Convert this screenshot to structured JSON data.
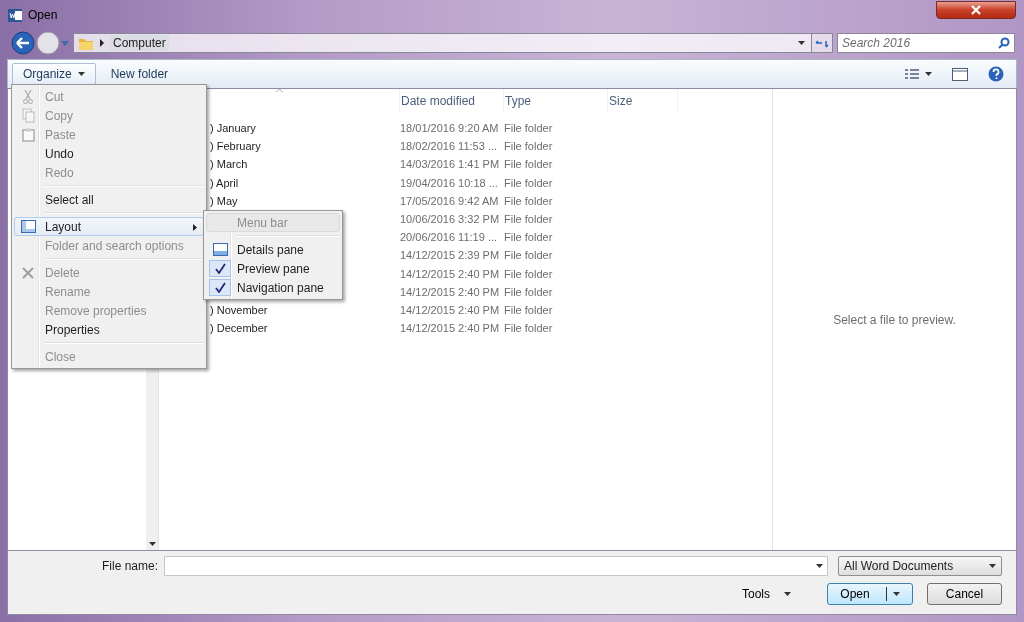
{
  "window": {
    "title": "Open"
  },
  "address": {
    "path": "Computer",
    "search_placeholder": "Search 2016"
  },
  "toolbar": {
    "buttons": [
      {
        "label": "Organize",
        "kind": "menu"
      },
      {
        "label": "New folder",
        "kind": "plain"
      }
    ]
  },
  "file_list": {
    "columns": [
      "Date modified",
      "Type",
      "Size"
    ],
    "rows": [
      {
        "name": ") January",
        "date": "18/01/2016 9:20 AM",
        "type": "File folder"
      },
      {
        "name": ") February",
        "date": "18/02/2016 11:53 ...",
        "type": "File folder"
      },
      {
        "name": ") March",
        "date": "14/03/2016 1:41 PM",
        "type": "File folder"
      },
      {
        "name": ") April",
        "date": "19/04/2016 10:18 ...",
        "type": "File folder"
      },
      {
        "name": ") May",
        "date": "17/05/2016 9:42 AM",
        "type": "File folder"
      },
      {
        "date": "10/06/2016 3:32 PM",
        "type": "File folder"
      },
      {
        "date": "20/06/2016 11:19 ...",
        "type": "File folder"
      },
      {
        "date": "14/12/2015 2:39 PM",
        "type": "File folder"
      },
      {
        "date": "14/12/2015 2:40 PM",
        "type": "File folder"
      },
      {
        "date": "14/12/2015 2:40 PM",
        "type": "File folder"
      },
      {
        "name": ") November",
        "date": "14/12/2015 2:40 PM",
        "type": "File folder"
      },
      {
        "name": ") December",
        "date": "14/12/2015 2:40 PM",
        "type": "File folder"
      }
    ]
  },
  "preview": {
    "message": "Select a file to preview."
  },
  "organize_menu": {
    "groups": [
      {
        "items": [
          {
            "label": "Cut",
            "disabled": true,
            "selected": false
          },
          {
            "label": "Copy",
            "disabled": true,
            "selected": false
          },
          {
            "label": "Paste",
            "disabled": true,
            "selected": false
          },
          {
            "label": "Undo",
            "disabled": false,
            "selected": false
          },
          {
            "label": "Redo",
            "disabled": true,
            "selected": false
          }
        ]
      },
      {
        "items": [
          {
            "label": "Select all",
            "disabled": false,
            "selected": false
          }
        ]
      },
      {
        "items": [
          {
            "label": "Layout",
            "disabled": false,
            "selected": true,
            "submenu": {
              "groups": [
                {
                  "items": [
                    {
                      "label": "Menu bar",
                      "disabled": true,
                      "selected": true,
                      "checked": false
                    }
                  ]
                },
                {
                  "items": [
                    {
                      "label": "Details pane",
                      "disabled": false,
                      "selected": false,
                      "checked": false
                    },
                    {
                      "label": "Preview pane",
                      "disabled": false,
                      "selected": false,
                      "checked": true
                    },
                    {
                      "label": "Navigation pane",
                      "disabled": false,
                      "selected": false,
                      "checked": true
                    }
                  ]
                }
              ]
            }
          },
          {
            "label": "Folder and search options",
            "disabled": true,
            "selected": false
          }
        ]
      },
      {
        "items": [
          {
            "label": "Delete",
            "disabled": true,
            "selected": false
          },
          {
            "label": "Rename",
            "disabled": true,
            "selected": false
          },
          {
            "label": "Remove properties",
            "disabled": true,
            "selected": false
          },
          {
            "label": "Properties",
            "disabled": false,
            "selected": false
          }
        ]
      },
      {
        "items": [
          {
            "label": "Close",
            "disabled": true,
            "selected": false
          }
        ]
      }
    ]
  },
  "footer": {
    "file_name_label": "File name:",
    "filter": "All Word Documents",
    "tools": "Tools",
    "buttons": [
      {
        "label": "Open",
        "kind": "split"
      },
      {
        "label": "Cancel",
        "kind": "plain"
      }
    ]
  }
}
